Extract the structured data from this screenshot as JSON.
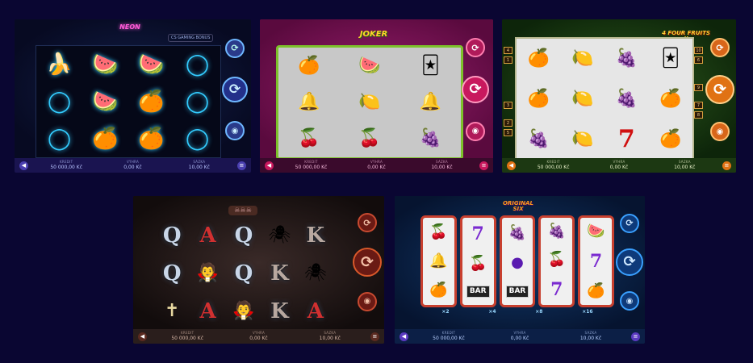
{
  "bar_labels": {
    "kredit": "KREDIT",
    "vyhra": "VÝHRA",
    "sazka": "SÁZKA"
  },
  "games": [
    {
      "id": "neon",
      "logo": "NEON",
      "badge": "CS GAMING BONUS",
      "kredit": "50 000,00 Kč",
      "vyhra": "0,00 Kč",
      "sazka": "10,00 Kč",
      "icons": [
        "banana-icon",
        "watermelon-icon",
        "orange-icon",
        "plum-icon"
      ]
    },
    {
      "id": "joker",
      "logo": "JOKER",
      "kredit": "50 000,00 Kč",
      "vyhra": "0,00 Kč",
      "sazka": "10,00 Kč"
    },
    {
      "id": "fourfruits",
      "logo": "4 FOUR FRUITS II",
      "kredit": "50 000,00 Kč",
      "vyhra": "0,00 Kč",
      "sazka": "10,00 Kč",
      "paylines_left": [
        "4",
        "1",
        "3",
        "2",
        "5"
      ],
      "paylines_right": [
        "10",
        "6",
        "9",
        "7",
        "8"
      ]
    },
    {
      "id": "vampire",
      "kredit": "50 000,00 Kč",
      "vyhra": "0,00 Kč",
      "sazka": "10,00 Kč",
      "cards": [
        [
          "Q",
          "A",
          "Q",
          "spider",
          "K"
        ],
        [
          "Q",
          "vampire",
          "Q",
          "K",
          "spider"
        ],
        [
          "cross",
          "A",
          "vampire",
          "K",
          "A"
        ]
      ]
    },
    {
      "id": "original",
      "logo": "ORIGINAL SIX",
      "kredit": "50 000,00 Kč",
      "vyhra": "0,00 Kč",
      "sazka": "10,00 Kč",
      "bar_text": "BAR",
      "multipliers": [
        "2",
        "4",
        "8",
        "16"
      ],
      "colors": {
        "accent": "#1f8bd6",
        "frame": "#c8402f"
      }
    }
  ]
}
